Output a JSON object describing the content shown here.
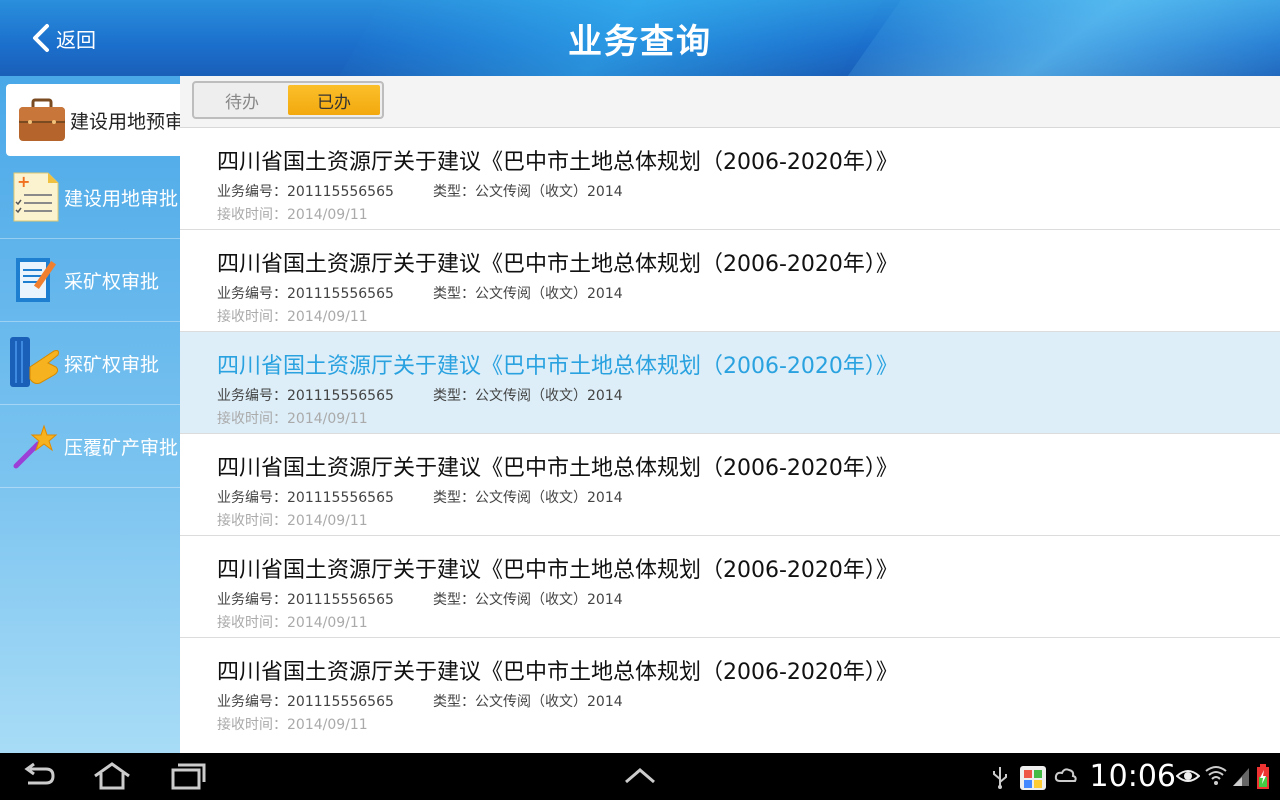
{
  "header": {
    "back_label": "返回",
    "title": "业务查询"
  },
  "sidebar": {
    "items": [
      {
        "label": "建设用地预审",
        "icon": "briefcase-icon"
      },
      {
        "label": "建设用地审批",
        "icon": "checklist-icon"
      },
      {
        "label": "采矿权审批",
        "icon": "document-pen-icon"
      },
      {
        "label": "探矿权审批",
        "icon": "pointing-hand-icon"
      },
      {
        "label": "压覆矿产审批",
        "icon": "magic-wand-icon"
      }
    ]
  },
  "tabs": {
    "pending": "待办",
    "done": "已办"
  },
  "rows": [
    {
      "title": "四川省国土资源厅关于建议《巴中市土地总体规划（2006-2020年）》",
      "number": "业务编号：201115556565",
      "type": "类型：公文传阅（收文）2014",
      "time": "接收时间：2014/09/11"
    },
    {
      "title": "四川省国土资源厅关于建议《巴中市土地总体规划（2006-2020年）》",
      "number": "业务编号：201115556565",
      "type": "类型：公文传阅（收文）2014",
      "time": "接收时间：2014/09/11"
    },
    {
      "title": "四川省国土资源厅关于建议《巴中市土地总体规划（2006-2020年）》",
      "number": "业务编号：201115556565",
      "type": "类型：公文传阅（收文）2014",
      "time": "接收时间：2014/09/11"
    },
    {
      "title": "四川省国土资源厅关于建议《巴中市土地总体规划（2006-2020年）》",
      "number": "业务编号：201115556565",
      "type": "类型：公文传阅（收文）2014",
      "time": "接收时间：2014/09/11"
    },
    {
      "title": "四川省国土资源厅关于建议《巴中市土地总体规划（2006-2020年）》",
      "number": "业务编号：201115556565",
      "type": "类型：公文传阅（收文）2014",
      "time": "接收时间：2014/09/11"
    },
    {
      "title": "四川省国土资源厅关于建议《巴中市土地总体规划（2006-2020年）》",
      "number": "业务编号：201115556565",
      "type": "类型：公文传阅（收文）2014",
      "time": "接收时间：2014/09/11"
    }
  ],
  "status_bar": {
    "time": "10:06"
  },
  "colors": {
    "accent": "#f3a90e",
    "selected_text": "#2aa2e0",
    "header_blue": "#1b6fcc"
  }
}
